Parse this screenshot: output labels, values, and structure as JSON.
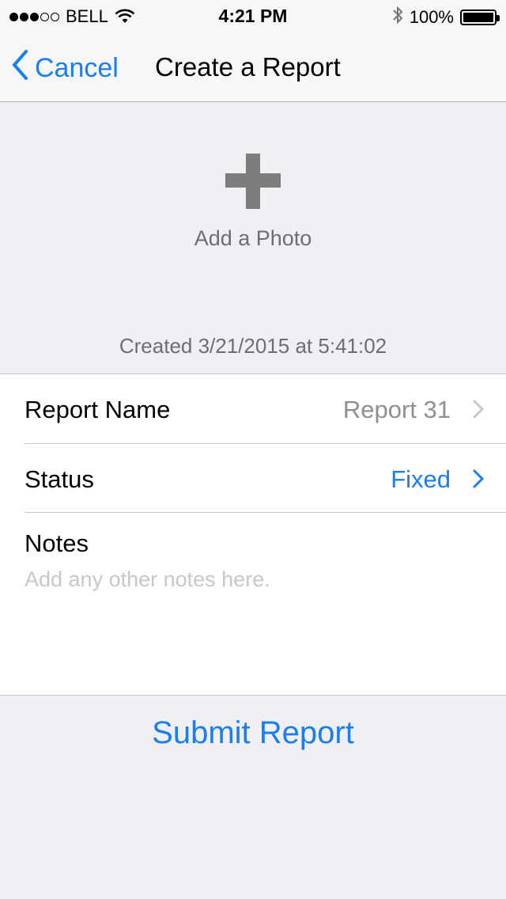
{
  "status_bar": {
    "carrier": "BELL",
    "time": "4:21 PM",
    "battery_text": "100%",
    "signal_bars_filled": 3,
    "signal_bars_total": 5
  },
  "nav": {
    "back_label": "Cancel",
    "title": "Create a Report"
  },
  "photo": {
    "label": "Add a Photo"
  },
  "created_text": "Created 3/21/2015 at 5:41:02",
  "fields": {
    "report_name": {
      "label": "Report Name",
      "value": "Report 31"
    },
    "status": {
      "label": "Status",
      "value": "Fixed"
    },
    "notes": {
      "label": "Notes",
      "placeholder": "Add any other notes here."
    }
  },
  "submit_label": "Submit Report",
  "colors": {
    "accent": "#1a7ef0",
    "background": "#efeff4",
    "secondary_text": "#8e8e93"
  }
}
